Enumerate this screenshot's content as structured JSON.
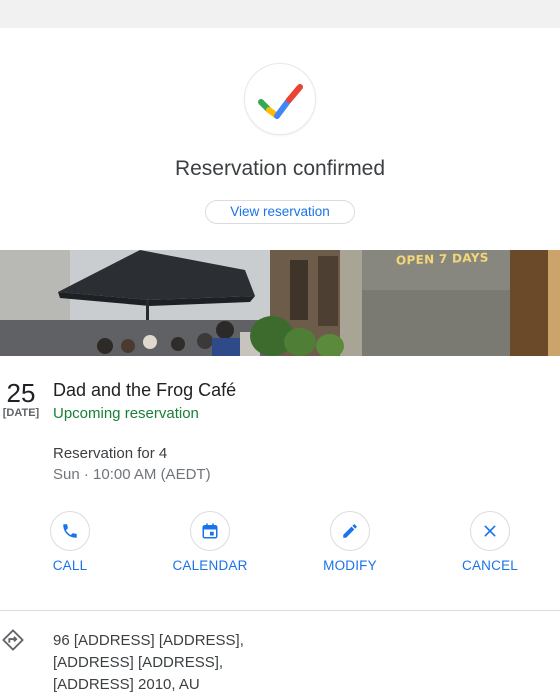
{
  "header": {
    "title": "Reservation confirmed",
    "view_button": "View reservation",
    "check_colors": [
      "#34a853",
      "#fbbc04",
      "#4285f4",
      "#ea4335"
    ]
  },
  "photo": {
    "sign_text": "OPEN 7 DAYS"
  },
  "reservation": {
    "date_day": "25",
    "date_label": "[DATE]",
    "venue_name": "Dad and the Frog Café",
    "status": "Upcoming reservation",
    "party": "Reservation for 4",
    "time": "Sun · 10:00 AM (AEDT)"
  },
  "actions": [
    {
      "label": "CALL",
      "icon": "phone-icon"
    },
    {
      "label": "CALENDAR",
      "icon": "calendar-icon"
    },
    {
      "label": "MODIFY",
      "icon": "pencil-icon"
    },
    {
      "label": "CANCEL",
      "icon": "close-icon"
    }
  ],
  "address": {
    "line1": "96 [ADDRESS] [ADDRESS],",
    "line2": "[ADDRESS] [ADDRESS],",
    "line3": "[ADDRESS] 2010, AU",
    "icon": "directions-icon"
  },
  "colors": {
    "accent": "#1a73e8",
    "status_green": "#188038"
  }
}
